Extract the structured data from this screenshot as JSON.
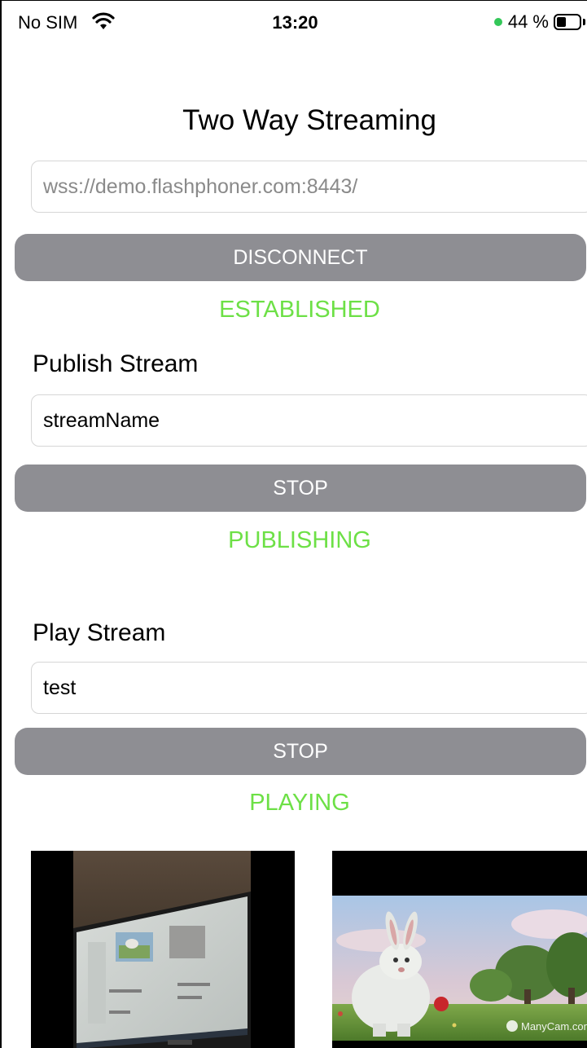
{
  "status_bar": {
    "carrier": "No SIM",
    "time": "13:20",
    "battery_percent": "44 %",
    "battery_level": 0.44,
    "charging_dot_color": "#34c759"
  },
  "title": "Two Way Streaming",
  "connection": {
    "server_url": "wss://demo.flashphoner.com:8443/",
    "button_label": "DISCONNECT",
    "status": "ESTABLISHED"
  },
  "publish": {
    "label": "Publish Stream",
    "stream_name": "streamName",
    "button_label": "STOP",
    "status": "PUBLISHING"
  },
  "play": {
    "label": "Play Stream",
    "stream_name": "test",
    "button_label": "STOP",
    "status": "PLAYING"
  },
  "videos": {
    "remote_watermark": "ManyCam.com"
  },
  "colors": {
    "button_bg": "#8e8e93",
    "status_green": "#6de046",
    "field_border": "#d6d6d6"
  }
}
